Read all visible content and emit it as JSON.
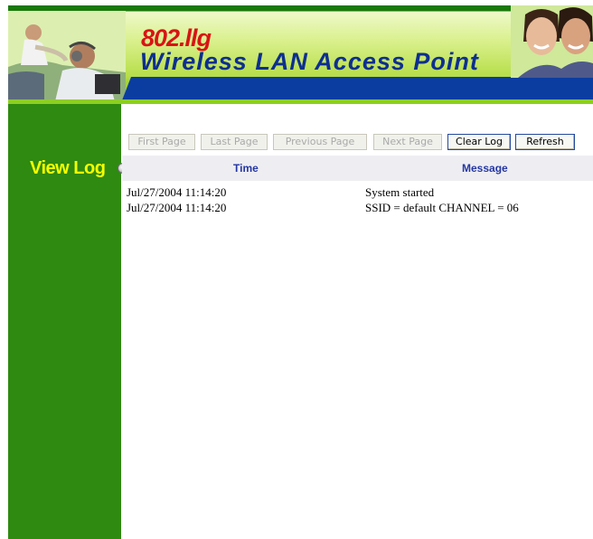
{
  "header": {
    "logo_small": "802.llg",
    "logo_big": "Wireless LAN Access Point"
  },
  "sidebar": {
    "title": "View Log"
  },
  "buttons": {
    "first_page": "First Page",
    "last_page": "Last Page",
    "previous_page": "Previous Page",
    "next_page": "Next Page",
    "clear_log": "Clear Log",
    "refresh": "Refresh"
  },
  "table": {
    "columns": [
      "Time",
      "Message"
    ],
    "rows": [
      {
        "time": "Jul/27/2004 11:14:20",
        "message": "System started"
      },
      {
        "time": "Jul/27/2004 11:14:20",
        "message": "SSID = default CHANNEL = 06"
      }
    ]
  },
  "colors": {
    "sidebar_green": "#2e8a10",
    "title_yellow": "#f4ff00",
    "header_blue": "#0b3da0",
    "column_header_text": "#2537a3"
  }
}
